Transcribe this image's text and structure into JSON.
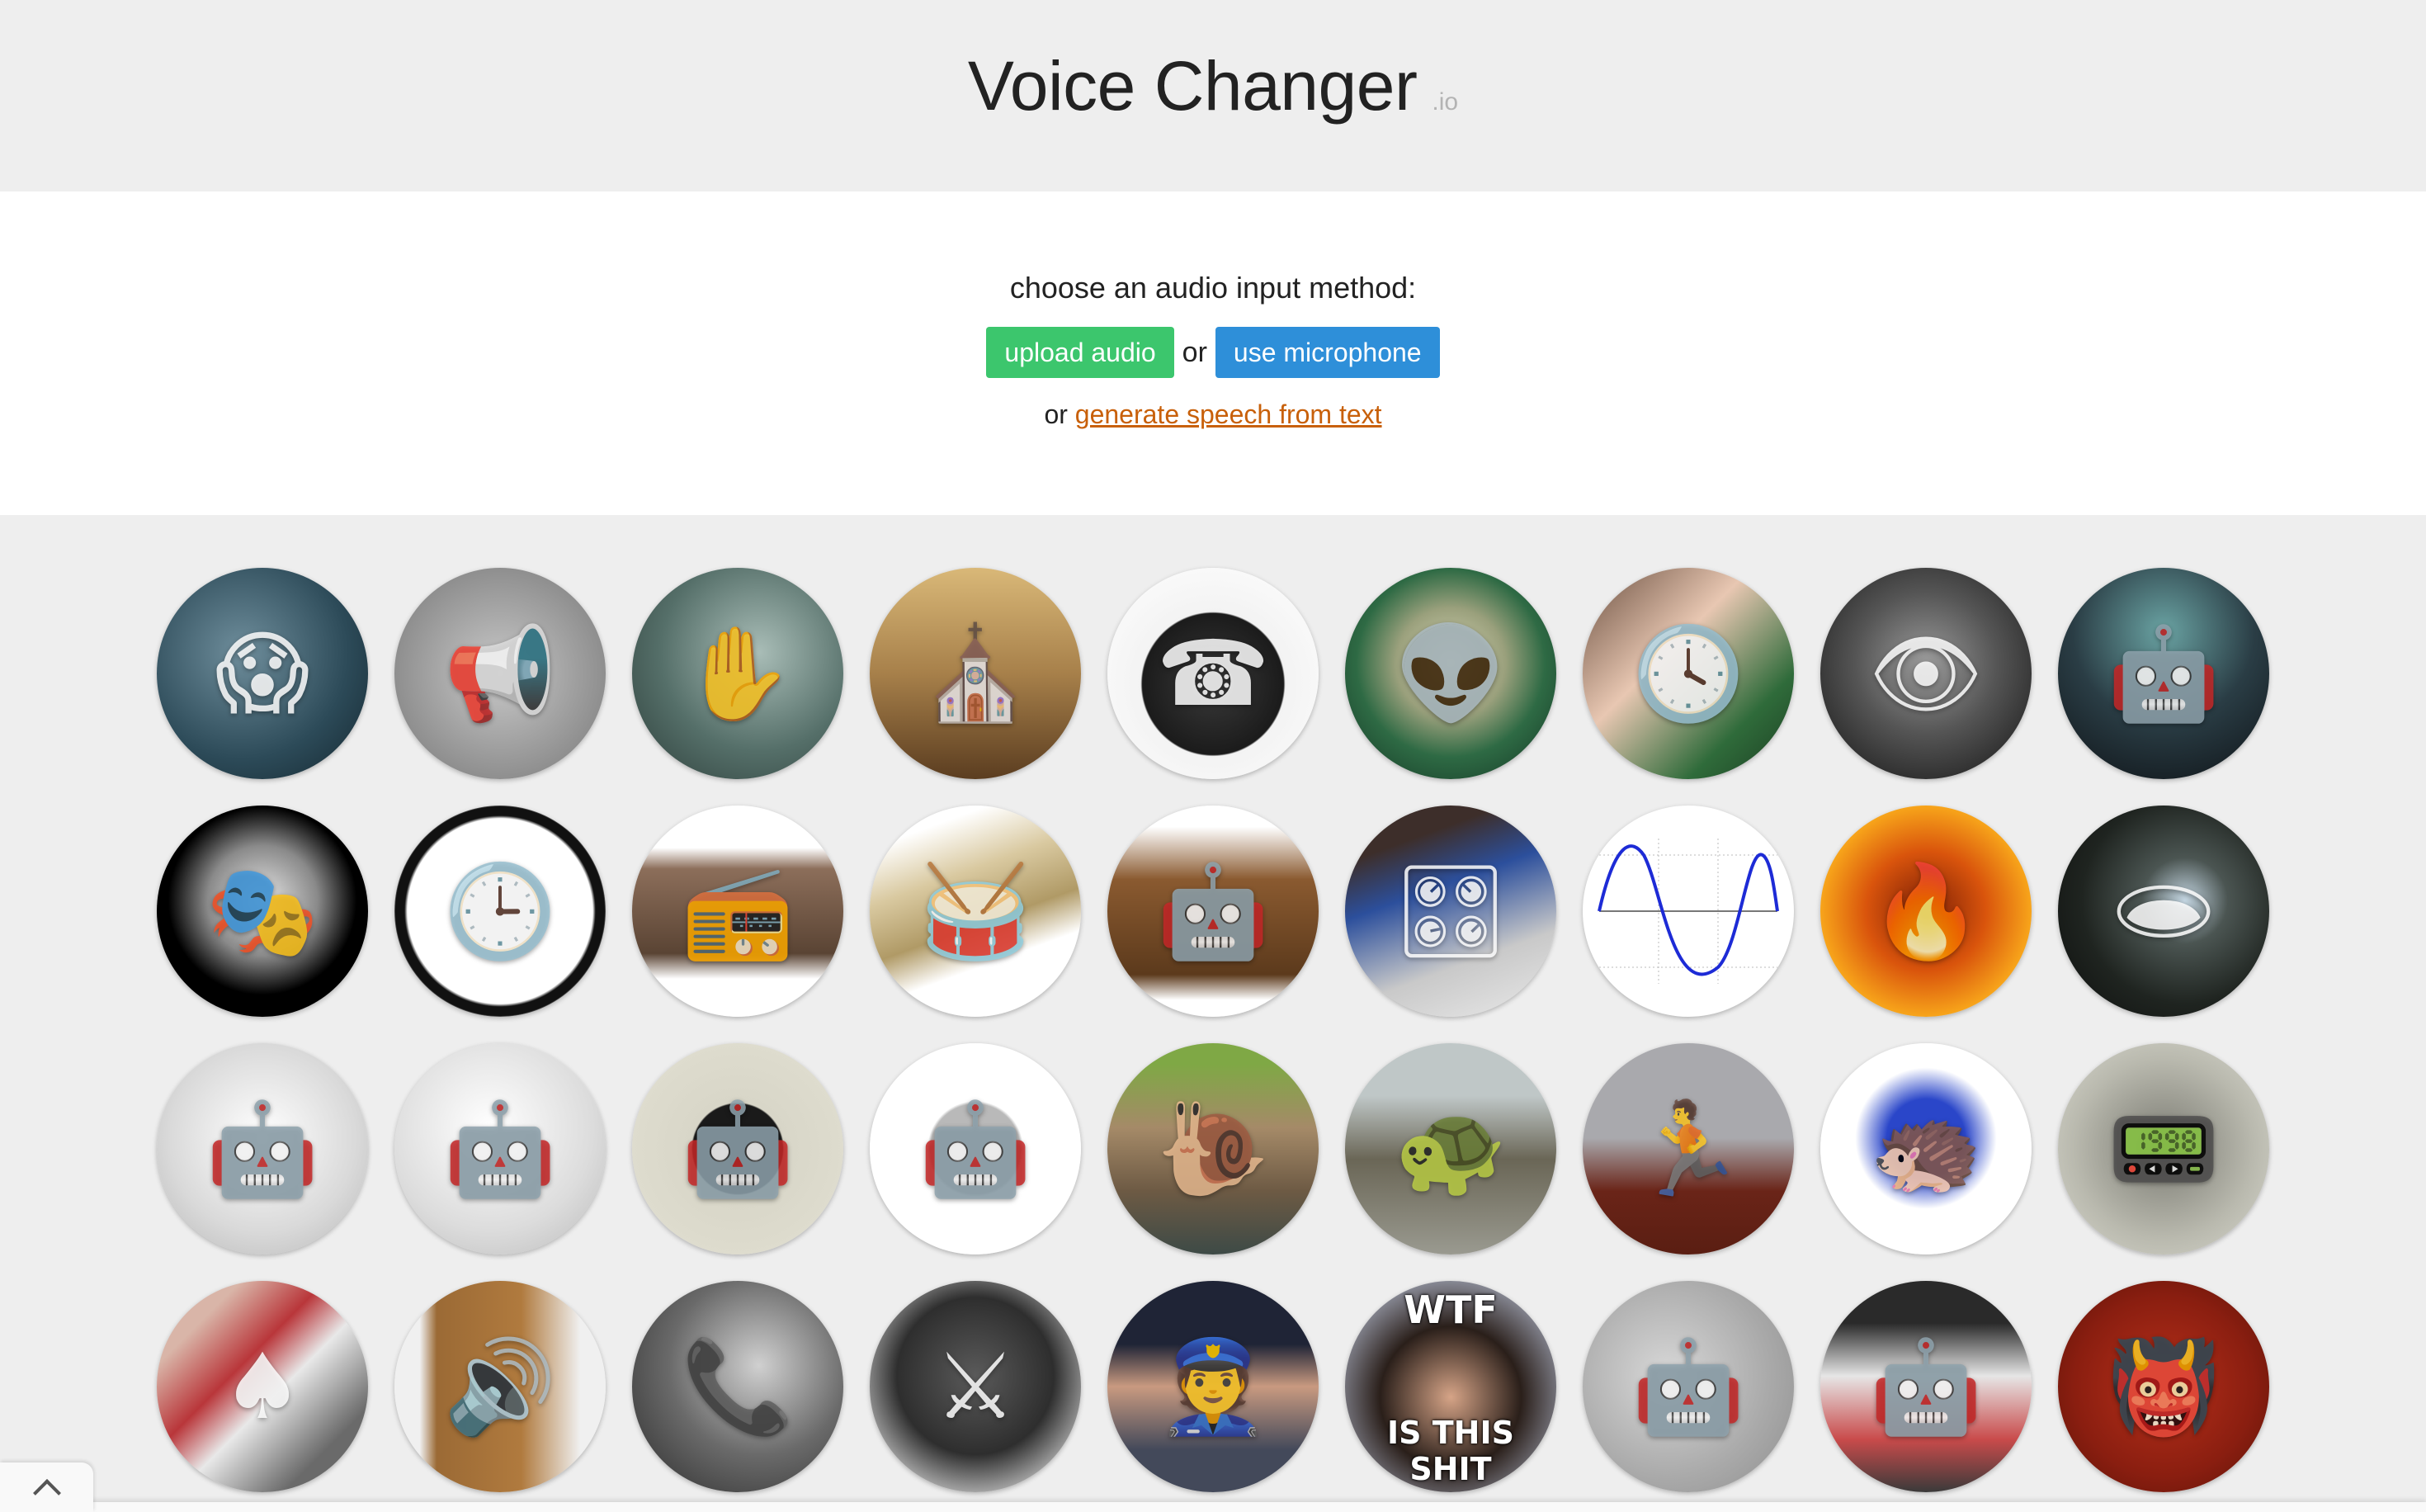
{
  "header": {
    "title": "Voice Changer",
    "title_suffix": ".io"
  },
  "input": {
    "prompt": "choose an audio input method:",
    "upload_label": "upload audio",
    "or_label": "or",
    "microphone_label": "use microphone",
    "alt_prefix": "or",
    "tts_link_label": "generate speech from text"
  },
  "colors": {
    "upload_button": "#3cc66d",
    "microphone_button": "#2e8fd9",
    "link": "#c8600a",
    "header_bg": "#eeeeee",
    "grid_bg": "#eeeeee"
  },
  "voices": [
    {
      "name": "screaming-monster",
      "glyph": "😱",
      "bg": "radial-gradient(circle at 40% 40%, #6f8e9c, #2c4a58 60%, #14262e)"
    },
    {
      "name": "megaphone-speakers",
      "glyph": "📢",
      "bg": "radial-gradient(circle at 50% 50%, #c9c9c9, #8f8f8f 70%, #6b6b6b)"
    },
    {
      "name": "ghost-silhouette",
      "glyph": "✋",
      "bg": "radial-gradient(circle at 60% 40%, #a9bdb7, #556f69 55%, #2c3d39)"
    },
    {
      "name": "cathedral",
      "glyph": "⛪",
      "bg": "linear-gradient(180deg, #d9b878, #a7804a 50%, #5b3d20)"
    },
    {
      "name": "rotary-telephone",
      "glyph": "☎",
      "bg": "radial-gradient(circle at 50% 55%, #3a3a3a, #1b1b1b 45%, #f3f3f3 46%, #ffffff)"
    },
    {
      "name": "grey-alien",
      "glyph": "👽",
      "bg": "radial-gradient(circle at 50% 45%, #d8d8b8, #9aa07c 35%, #2e6a44 60%, #123322)"
    },
    {
      "name": "melting-clock",
      "glyph": "🕓",
      "bg": "linear-gradient(135deg, #6a4f40, #e8c7b2 40%, #2f6b3a 75%, #1c3d22)"
    },
    {
      "name": "dark-alien",
      "glyph": "👁",
      "bg": "radial-gradient(circle at 50% 45%, #9a9a9a, #555555 45%, #111111)"
    },
    {
      "name": "cyborg-bust",
      "glyph": "🤖",
      "bg": "radial-gradient(circle at 50% 30%, #6aa3a3, #2a3d45 50%, #0e1216)"
    },
    {
      "name": "anonymous-mask",
      "glyph": "🎭",
      "bg": "radial-gradient(circle at 50% 45%, #e6e6e6, #8a8a8a 35%, #000000 60%)"
    },
    {
      "name": "reversed-clock",
      "glyph": "🕒",
      "bg": "radial-gradient(circle, #ffffff 62%, #111111 64%, #111111 70%, #ffffff 72%)"
    },
    {
      "name": "vintage-radio",
      "glyph": "📻",
      "bg": "linear-gradient(180deg, #ffffff 20%, #8c6e5a 30%, #5a4434 70%, #ffffff 82%)"
    },
    {
      "name": "cymbal",
      "glyph": "🥁",
      "bg": "linear-gradient(160deg, #ffffff 15%, #d9c9a0 35%, #b09a66 55%, #ffffff 70%)"
    },
    {
      "name": "dalek",
      "glyph": "🤖",
      "bg": "linear-gradient(180deg, #ffffff 10%, #8a5a30 35%, #5c3a1c 80%, #ffffff 92%)"
    },
    {
      "name": "mutron-pedal",
      "glyph": "🎛",
      "bg": "linear-gradient(160deg, #3d2e2a 20%, #2c4f9c 40%, #c9c9c9 70%, #e9e9e9)"
    },
    {
      "name": "sine-wave",
      "glyph": "∿",
      "bg": "#ffffff"
    },
    {
      "name": "balrog-fire",
      "glyph": "🔥",
      "bg": "radial-gradient(circle at 50% 50%, #7a1e06, #d9540c 40%, #f7a31a 70%, #f3c040)"
    },
    {
      "name": "cave",
      "glyph": "🕳",
      "bg": "radial-gradient(circle at 60% 45%, #c4d6e2, #4b5552 25%, #1f2420 60%, #0c0d0c)"
    },
    {
      "name": "robot-walker-1",
      "glyph": "🤖",
      "bg": "radial-gradient(circle at 50% 45%, #ffffff, #d9d9d9 60%, #b5b5b5)"
    },
    {
      "name": "robot-walker-2",
      "glyph": "🤖",
      "bg": "radial-gradient(circle at 45% 40%, #ffffff, #dcdcdc 60%, #b8b8b8)"
    },
    {
      "name": "tin-toy-robot",
      "glyph": "🤖",
      "bg": "radial-gradient(circle at 50% 50%, #1a1a1a 30%, #d8d6c8 31%, #e2e0d2)"
    },
    {
      "name": "lego-robot",
      "glyph": "🤖",
      "bg": "radial-gradient(circle at 50% 50%, #b9b9b9 30%, #ffffff 32%)"
    },
    {
      "name": "snail",
      "glyph": "🐌",
      "bg": "linear-gradient(180deg, #7fa845 10%, #a58a68 40%, #6d5a44 70%, #3d4a46)"
    },
    {
      "name": "tortoise",
      "glyph": "🐢",
      "bg": "linear-gradient(180deg, #bfc7c7 25%, #6a6656 55%, #9a9a90)"
    },
    {
      "name": "sprinter",
      "glyph": "🏃",
      "bg": "linear-gradient(180deg, #a9a9ad 45%, #6a2418 70%, #5a1e12)"
    },
    {
      "name": "sonic",
      "glyph": "🦔",
      "bg": "radial-gradient(circle at 50% 45%, #2a46c9 25%, #ffffff 45%)"
    },
    {
      "name": "soldier-radio",
      "glyph": "📟",
      "bg": "radial-gradient(circle at 50% 50%, #7a7a72, #b9b9ae 60%, #d9d9cf)"
    },
    {
      "name": "card-shuffle",
      "glyph": "♠",
      "bg": "linear-gradient(135deg, #d9b5a8 20%, #b9363a 40%, #e8e8e8 55%, #6a6a6a 80%)"
    },
    {
      "name": "radio-speaker-cabinet",
      "glyph": "🔊",
      "bg": "linear-gradient(90deg, #f0f0f0 12%, #9b6a35 20%, #b07a3e 60%, #f0f0f0 88%)"
    },
    {
      "name": "early-telephone-man",
      "glyph": "📞",
      "bg": "radial-gradient(circle at 60% 40%, #d0d0d0, #6a6a6a 50%, #2a2a2a)"
    },
    {
      "name": "dark-armor",
      "glyph": "⚔",
      "bg": "radial-gradient(circle at 50% 45%, #5a5a5a, #2e2e2e 50%, #d9d9d9 85%)"
    },
    {
      "name": "russian-officer",
      "glyph": "👮",
      "bg": "linear-gradient(180deg, #1f2436 30%, #c99a80 50%, #43495a 80%)"
    },
    {
      "name": "wtf-meme",
      "glyph": "",
      "meme_top": "WTF",
      "meme_bottom": "IS THIS SHIT",
      "bg": "radial-gradient(circle at 50% 55%, #d6a487, #2a1f1a 45%, #8a8c98 75%)"
    },
    {
      "name": "gir-robot",
      "glyph": "🤖",
      "bg": "radial-gradient(circle at 40% 45%, #d8d8d8, #a9a9a9 60%, #8d8d8d)"
    },
    {
      "name": "kirobo-robot",
      "glyph": "🤖",
      "bg": "linear-gradient(180deg, #2a2a2a 20%, #e6e6e6 45%, #c94b4b 75%, #3a3a3a)"
    },
    {
      "name": "red-demon",
      "glyph": "👹",
      "bg": "radial-gradient(circle at 50% 50%, #b8301a, #8a1e10 60%, #5a1208)"
    }
  ],
  "scroll_top": {
    "icon": "chevron-up-icon"
  }
}
